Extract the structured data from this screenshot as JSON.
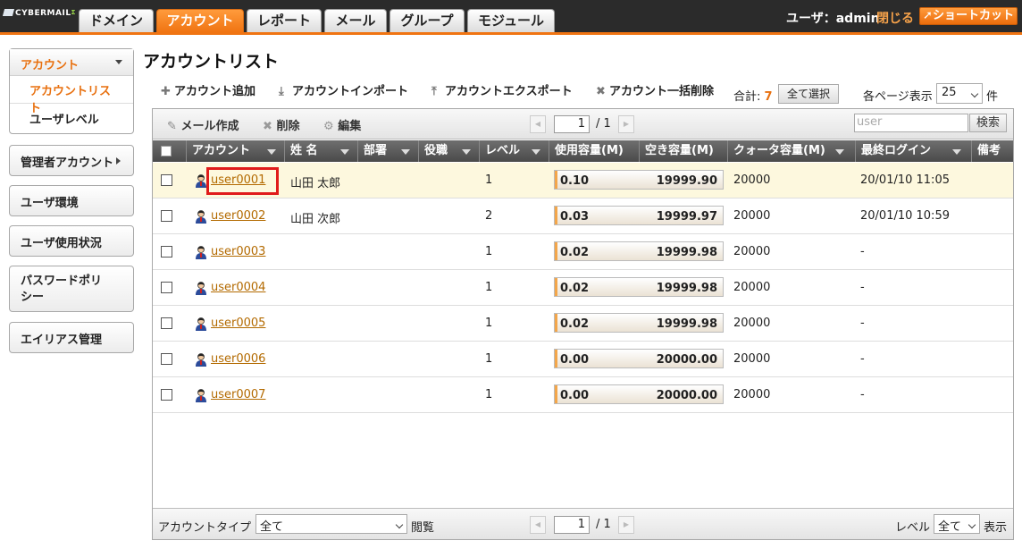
{
  "header": {
    "logo": "CYBERMAIL",
    "logo_suffix": "Σ",
    "tabs": [
      {
        "label": "ドメイン"
      },
      {
        "label": "アカウント"
      },
      {
        "label": "レポート"
      },
      {
        "label": "メール"
      },
      {
        "label": "グループ"
      },
      {
        "label": "モジュール"
      }
    ],
    "active_tab": "アカウント",
    "user_label": "ユーザ：admin",
    "logout_label": "閉じる",
    "shortcut_label": "ショートカット"
  },
  "sidebar": {
    "account_heading": "アカウント",
    "account_items": [
      "アカウントリスト",
      "ユーザレベル"
    ],
    "boxes": [
      "管理者アカウント",
      "ユーザ環境",
      "ユーザ使用状況",
      "パスワードポリシー",
      "エイリアス管理"
    ]
  },
  "main": {
    "title": "アカウントリスト",
    "actions": [
      "アカウント追加",
      "アカウントインポート",
      "アカウントエクスポート",
      "アカウント一括削除"
    ],
    "total_label": "合計:",
    "total_count": "7",
    "select_all": "全て選択",
    "per_page_label": "各ページ表示",
    "per_page_value": "25",
    "per_page_unit": "件"
  },
  "grid": {
    "toolbar": {
      "compose": "メール作成",
      "delete": "削除",
      "edit": "編集",
      "page": "1",
      "page_total": "/ 1",
      "search_value": "user",
      "search_button": "検索"
    },
    "columns": [
      "アカウント",
      "姓 名",
      "部署",
      "役職",
      "レベル",
      "使用容量(M)",
      "空き容量(M)",
      "クォータ容量(M)",
      "最終ログイン",
      "備考"
    ],
    "rows": [
      {
        "account": "user0001",
        "name": "山田 太郎",
        "level": "1",
        "used": "0.10",
        "free": "19999.90",
        "quota": "20000",
        "last_login": "20/01/10 11:05"
      },
      {
        "account": "user0002",
        "name": "山田 次郎",
        "level": "2",
        "used": "0.03",
        "free": "19999.97",
        "quota": "20000",
        "last_login": "20/01/10 10:59"
      },
      {
        "account": "user0003",
        "name": "",
        "level": "1",
        "used": "0.02",
        "free": "19999.98",
        "quota": "20000",
        "last_login": "-"
      },
      {
        "account": "user0004",
        "name": "",
        "level": "1",
        "used": "0.02",
        "free": "19999.98",
        "quota": "20000",
        "last_login": "-"
      },
      {
        "account": "user0005",
        "name": "",
        "level": "1",
        "used": "0.02",
        "free": "19999.98",
        "quota": "20000",
        "last_login": "-"
      },
      {
        "account": "user0006",
        "name": "",
        "level": "1",
        "used": "0.00",
        "free": "20000.00",
        "quota": "20000",
        "last_login": "-"
      },
      {
        "account": "user0007",
        "name": "",
        "level": "1",
        "used": "0.00",
        "free": "20000.00",
        "quota": "20000",
        "last_login": "-"
      }
    ],
    "footer": {
      "type_label": "アカウントタイプ",
      "type_value": "全て",
      "view_label": "閲覧",
      "page": "1",
      "page_total": "/ 1",
      "level_label": "レベル",
      "level_value": "全て",
      "display_label": "表示"
    }
  },
  "colors": {
    "accent": "#f07412",
    "header_bg": "#2b2b2b",
    "highlight": "#e01b1b"
  }
}
